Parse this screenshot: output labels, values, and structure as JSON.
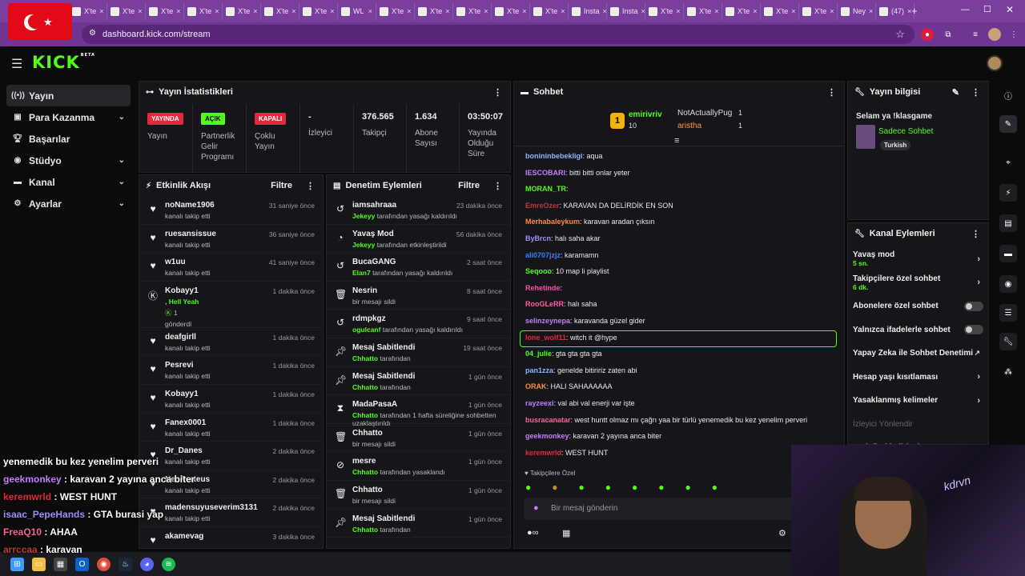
{
  "browser": {
    "tabs": [
      "X'te",
      "X'te",
      "X'te",
      "X'te",
      "X'te",
      "X'te",
      "X'te",
      "WL",
      "X'te",
      "X'te",
      "X'te",
      "X'te",
      "X'te",
      "Insta",
      "Insta",
      "X'te",
      "X'te",
      "X'te",
      "X'te",
      "X'te",
      "Ney",
      "(47)"
    ],
    "url": "dashboard.kick.com/stream",
    "new_tab": "+"
  },
  "app": {
    "logo": "KICK",
    "logo_tag": "BETA"
  },
  "sidebar": {
    "items": [
      {
        "label": "Yayın",
        "icon": "broadcast-icon"
      },
      {
        "label": "Para Kazanma",
        "icon": "money-icon"
      },
      {
        "label": "Başarılar",
        "icon": "trophy-icon"
      },
      {
        "label": "Stüdyo",
        "icon": "studio-icon"
      },
      {
        "label": "Kanal",
        "icon": "channel-icon"
      },
      {
        "label": "Ayarlar",
        "icon": "gear-icon"
      }
    ]
  },
  "stats": {
    "title": "Yayın İstatistikleri",
    "cols": [
      {
        "badge": "YAYINDA",
        "badge_color": "#e5283c",
        "label": "Yayın"
      },
      {
        "badge": "AÇIK",
        "badge_color": "#53fc18",
        "label": "Partnerlik Gelir Programı"
      },
      {
        "badge": "KAPALI",
        "badge_color": "#e5283c",
        "label": "Çoklu Yayın"
      },
      {
        "value": "-",
        "label": "İzleyici"
      },
      {
        "value": "376.565",
        "label": "Takipçi"
      },
      {
        "value": "1.634",
        "label": "Abone Sayısı"
      },
      {
        "value": "03:50:07",
        "label": "Yayında Olduğu Süre"
      }
    ]
  },
  "activity": {
    "title": "Etkinlik Akışı",
    "filter": "Filtre",
    "rows": [
      {
        "name": "noName1906",
        "sub": "kanalı takip etti",
        "time": "31 saniye önce"
      },
      {
        "name": "ruesansissue",
        "sub": "kanalı takip etti",
        "time": "36 saniye önce"
      },
      {
        "name": "w1uu",
        "sub": "kanalı takip etti",
        "time": "41 saniye önce"
      },
      {
        "name": "Kobayy1",
        "sub": ", Hell Yeah",
        "extra": "1",
        "extra2": "gönderdi",
        "time": "1 dakika önce"
      },
      {
        "name": "deafgirll",
        "sub": "kanalı takip etti",
        "time": "1 dakika önce"
      },
      {
        "name": "Pesrevi",
        "sub": "kanalı takip etti",
        "time": "1 dakika önce"
      },
      {
        "name": "Kobayy1",
        "sub": "kanalı takip etti",
        "time": "1 dakika önce"
      },
      {
        "name": "Fanex0001",
        "sub": "kanalı takip etti",
        "time": "1 dakika önce"
      },
      {
        "name": "Dr_Danes",
        "sub": "kanalı takip etti",
        "time": "2 dakika önce"
      },
      {
        "name": "NeoPorteus",
        "sub": "kanalı takip etti",
        "time": "2 dakika önce"
      },
      {
        "name": "madensuyuseverim3131",
        "sub": "kanalı takip etti",
        "time": "2 dakika önce"
      },
      {
        "name": "akamevag",
        "sub": "",
        "time": "3 dakika önce"
      }
    ]
  },
  "moderation": {
    "title": "Denetim Eylemleri",
    "filter": "Filtre",
    "rows": [
      {
        "name": "iamsahraaa",
        "g": "Jekeyy",
        "sub": "tarafından yasağı kaldırıldı",
        "time": "23 dakika önce",
        "icon": "undo-icon"
      },
      {
        "name": "Yavaş Mod",
        "g": "Jekeyy",
        "sub": "tarafından etkinleştirildi",
        "time": "56 dakika önce",
        "icon": "slow-icon"
      },
      {
        "name": "BucaGANG",
        "g": "Elan7",
        "sub": "tarafından yasağı kaldırıldı",
        "time": "2 saat önce",
        "icon": "undo-icon"
      },
      {
        "name": "Nesrin",
        "g": "",
        "sub": "bir mesajı sildi",
        "time": "8 saat önce",
        "icon": "trash-icon"
      },
      {
        "name": "rdmpkgz",
        "g": "ogulcanf",
        "sub": "tarafından yasağı kaldırıldı",
        "time": "9 saat önce",
        "icon": "undo-icon"
      },
      {
        "name": "Mesaj Sabitlendi",
        "g": "Chhatto",
        "sub": "tarafından",
        "time": "19 saat önce",
        "icon": "pin-icon"
      },
      {
        "name": "Mesaj Sabitlendi",
        "g": "Chhatto",
        "sub": "tarafından",
        "time": "1 gün önce",
        "icon": "pin-icon"
      },
      {
        "name": "MadaPasaA",
        "g": "Chhatto",
        "sub": "tarafından 1 hafta süreliğine sohbetten uzaklaştırıldı",
        "time": "1 gün önce",
        "icon": "hourglass-icon"
      },
      {
        "name": "Chhatto",
        "g": "",
        "sub": "bir mesajı sildi",
        "time": "1 gün önce",
        "icon": "trash-icon"
      },
      {
        "name": "mesre",
        "g": "Chhatto",
        "sub": "tarafından yasaklandı",
        "time": "1 gün önce",
        "icon": "ban-icon"
      },
      {
        "name": "Chhatto",
        "g": "",
        "sub": "bir mesajı sildi",
        "time": "1 gün önce",
        "icon": "trash-icon"
      },
      {
        "name": "Mesaj Sabitlendi",
        "g": "Chhatto",
        "sub": "tarafından",
        "time": "1 gün önce",
        "icon": "pin-icon"
      }
    ]
  },
  "chat": {
    "title": "Sohbet",
    "top": {
      "rank": "1",
      "user1": "emirivriv",
      "count1": "10",
      "user2": "NotActuallyPug",
      "count2": "1",
      "user3": "aristha",
      "count3": "1"
    },
    "messages": [
      {
        "user": "bonininbebekligi",
        "color": "#8fb4ff",
        "text": ": aqua"
      },
      {
        "user": "IESCOBARI",
        "color": "#c77dff",
        "text": ": bitti bitti onlar yeter"
      },
      {
        "user": "MORAN_TR",
        "color": "#53fc18",
        "text": ":"
      },
      {
        "user": "EmreOzer",
        "color": "#c03838",
        "text": ": KARAVAN DA DELİRDİK EN SON"
      },
      {
        "user": "Merhabaleykum",
        "color": "#ff8a3d",
        "text": ": karavan aradan çıksın"
      },
      {
        "user": "ByBrcn",
        "color": "#a78bfa",
        "text": ": halı saha akar"
      },
      {
        "user": "ali0707jzjz",
        "color": "#3b82f6",
        "text": ": karamamn"
      },
      {
        "user": "Seqooo",
        "color": "#53fc18",
        "text": ": 10 map li playlist"
      },
      {
        "user": "Rehetinde",
        "color": "#ff4fa3",
        "text": ":"
      },
      {
        "user": "RooGLeRR",
        "color": "#ff5fa0",
        "text": ": halı saha"
      },
      {
        "user": "selinzeynepa",
        "color": "#c77dff",
        "text": ": karavanda güzel gider"
      },
      {
        "user": "lone_wolf11",
        "color": "#e5283c",
        "text": ": witch it @hype"
      },
      {
        "user": "04_julie",
        "color": "#53fc18",
        "text": ": gta gta gta gta"
      },
      {
        "user": "pan1zza",
        "color": "#8fb4ff",
        "text": ": genelde bitiririz zaten abi"
      },
      {
        "user": "ORAK",
        "color": "#ff8a3d",
        "text": ": HALI SAHAAAAAA"
      },
      {
        "user": "rayzeexi",
        "color": "#c77dff",
        "text": ": val abi val enerji var işte"
      },
      {
        "user": "busracanatar",
        "color": "#ff5fa0",
        "text": ": west huntt olmaz mı çağrı yaa bir türlü yenemedik bu kez yenelim perveri"
      },
      {
        "user": "geekmonkey",
        "color": "#c77dff",
        "text": ": karavan 2 yayına anca biter"
      },
      {
        "user": "keremwrld",
        "color": "#e5283c",
        "text": ": WEST HUNT"
      }
    ],
    "followers_only": "Takipçilere Özel",
    "placeholder": "Bir mesaj gönderin"
  },
  "streaminfo": {
    "title": "Yayın bilgisi",
    "stream_title": "Selam ya !klasgame",
    "category": "Sadece Sohbet",
    "tag": "Turkish"
  },
  "channel_actions": {
    "title": "Kanal Eylemleri",
    "items": [
      {
        "label": "Yavaş mod",
        "sub": "5 sn.",
        "type": "chevron"
      },
      {
        "label": "Takipçilere özel sohbet",
        "sub": "6 dk.",
        "type": "chevron"
      },
      {
        "label": "Abonelere özel sohbet",
        "type": "toggle"
      },
      {
        "label": "Yalnızca ifadelerle sohbet",
        "type": "toggle"
      },
      {
        "label": "Yapay Zeka ile Sohbet Denetimi",
        "type": "external"
      },
      {
        "label": "Hesap yaşı kısıtlaması",
        "type": "chevron"
      },
      {
        "label": "Yasaklanmış kelimeler",
        "type": "chevron"
      },
      {
        "label": "İzleyici Yönlendir",
        "type": "disabled"
      },
      {
        "label": "Hedefleri belirleyin",
        "type": "chevron"
      }
    ]
  },
  "overlay": [
    {
      "user": "",
      "color": "#ffffff",
      "text": "yenemedik bu kez yenelim perveri"
    },
    {
      "user": "geekmonkey",
      "color": "#c77dff",
      "text": " : karavan 2 yayına anca biter"
    },
    {
      "user": "keremwrld",
      "color": "#e5283c",
      "text": " : WEST HUNT"
    },
    {
      "user": "isaac_PepeHands",
      "color": "#a78bfa",
      "text": " : GTA burasi yap"
    },
    {
      "user": "FreaQ10",
      "color": "#ff5fa0",
      "text": " : AHAA"
    },
    {
      "user": "arrccaa",
      "color": "#c03838",
      "text": " : karavan"
    }
  ]
}
